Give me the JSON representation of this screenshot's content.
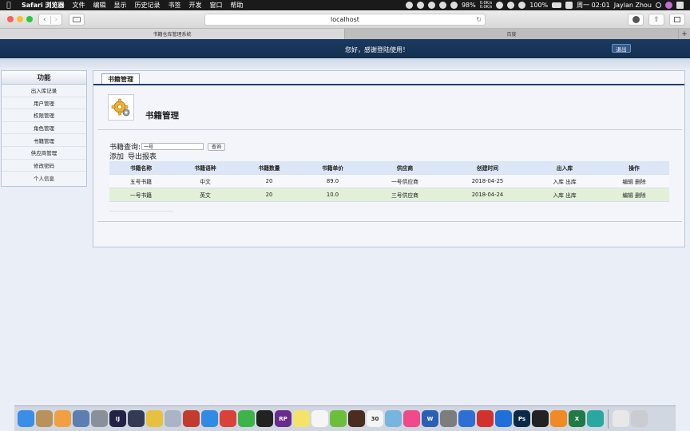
{
  "menubar": {
    "app": "Safari 浏览器",
    "items": [
      "文件",
      "编辑",
      "显示",
      "历史记录",
      "书签",
      "开发",
      "窗口",
      "帮助"
    ],
    "battery": "98%",
    "net_up": "0.0K/s",
    "net_down": "0.0K/s",
    "power": "100%",
    "clock": "周一 02:01",
    "user": "Jaylan Zhou"
  },
  "browser": {
    "url": "localhost",
    "tabs": [
      "书籍仓库管理系统",
      "百度"
    ],
    "new_tab": "+"
  },
  "header": {
    "welcome": "您好，感谢登陆使用！",
    "logout": "退出"
  },
  "sidebar": {
    "title": "功能",
    "items": [
      "出入库记录",
      "用户管理",
      "权限管理",
      "角色管理",
      "书籍管理",
      "供应商管理",
      "修改密码",
      "个人信息"
    ]
  },
  "main": {
    "tab_label": "书籍管理",
    "page_title": "书籍管理",
    "query_label": "书籍查询:",
    "query_value": "一号",
    "query_button": "查询",
    "add_link": "添加",
    "export_link": "导出报表"
  },
  "table": {
    "columns": [
      "书籍名称",
      "书籍语种",
      "书籍数量",
      "书籍单价",
      "供应商",
      "创建时间",
      "出入库",
      "操作"
    ],
    "rows": [
      {
        "name": "五号书籍",
        "language": "中文",
        "quantity": "20",
        "price": "89.0",
        "supplier": "一号供应商",
        "created": "2018-04-25",
        "stock_in": "入库",
        "stock_out": "出库",
        "edit": "编辑",
        "delete": "删除"
      },
      {
        "name": "一号书籍",
        "language": "英文",
        "quantity": "20",
        "price": "10.0",
        "supplier": "三号供应商",
        "created": "2018-04-24",
        "stock_in": "入库",
        "stock_out": "出库",
        "edit": "编辑",
        "delete": "删除"
      }
    ]
  },
  "dock": {
    "labels": {
      "intellij": "IJ",
      "axure": "RP",
      "calendar": "30",
      "word": "W",
      "photoshop": "Ps",
      "excel": "X"
    },
    "apps": [
      {
        "name": "finder-icon",
        "color": "#3a8ee6"
      },
      {
        "name": "notes-icon",
        "color": "#b8925a"
      },
      {
        "name": "photos-icon",
        "color": "#f0a040"
      },
      {
        "name": "preview-icon",
        "color": "#5b7fb0"
      },
      {
        "name": "launchpad-icon",
        "color": "#8a8f9a"
      },
      {
        "name": "intellij-icon",
        "color": "#222244"
      },
      {
        "name": "sublime-icon",
        "color": "#333a55"
      },
      {
        "name": "weather-icon",
        "color": "#e8c040"
      },
      {
        "name": "disk-icon",
        "color": "#aab4c8"
      },
      {
        "name": "redis-icon",
        "color": "#c33b2c"
      },
      {
        "name": "safari-icon",
        "color": "#2f8be6"
      },
      {
        "name": "presentation-icon",
        "color": "#d9413a"
      },
      {
        "name": "wechat-icon",
        "color": "#3db34a"
      },
      {
        "name": "qq-icon",
        "color": "#222"
      },
      {
        "name": "axure-icon",
        "color": "#6a2b8e"
      },
      {
        "name": "stickies-icon",
        "color": "#f2e36a"
      },
      {
        "name": "tasks-icon",
        "color": "#f5f5f5"
      },
      {
        "name": "maps-icon",
        "color": "#6cbf3b"
      },
      {
        "name": "hat-icon",
        "color": "#4b2c20"
      },
      {
        "name": "calendar-icon",
        "color": "#f4f4f4"
      },
      {
        "name": "maps2-icon",
        "color": "#76b5e0"
      },
      {
        "name": "music-icon",
        "color": "#f04a8a"
      },
      {
        "name": "word-icon",
        "color": "#2b5fb4"
      },
      {
        "name": "settings-icon",
        "color": "#7d7d7d"
      },
      {
        "name": "baidu-icon",
        "color": "#2e6fd6"
      },
      {
        "name": "remote-icon",
        "color": "#d2322d"
      },
      {
        "name": "teamviewer-icon",
        "color": "#1e6fd9"
      },
      {
        "name": "photoshop-icon",
        "color": "#0b2a4a"
      },
      {
        "name": "qq2-icon",
        "color": "#222"
      },
      {
        "name": "sublime2-icon",
        "color": "#f08a24"
      },
      {
        "name": "excel-icon",
        "color": "#1f7a45"
      },
      {
        "name": "chrome-icon",
        "color": "#2aa8a0"
      },
      {
        "name": "docs-icon",
        "color": "#e8e8e8"
      },
      {
        "name": "trash-icon",
        "color": "#c9ccd1"
      }
    ]
  }
}
